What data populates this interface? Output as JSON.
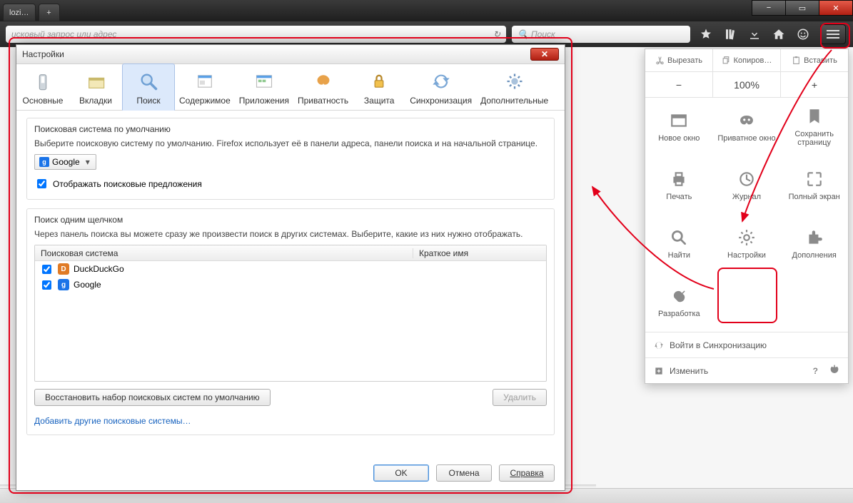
{
  "window": {
    "tab_label": "lozi…",
    "addr_placeholder": "исковый запрос или адрес",
    "search_placeholder": "Поиск"
  },
  "toolbar_icons": [
    "star",
    "library",
    "download",
    "home",
    "face",
    "menu"
  ],
  "menu": {
    "cut": "Вырезать",
    "copy": "Копиров…",
    "paste": "Вставить",
    "zoom_minus": "−",
    "zoom_value": "100%",
    "zoom_plus": "+",
    "grid": [
      {
        "label": "Новое окно"
      },
      {
        "label": "Приватное окно"
      },
      {
        "label": "Сохранить страницу"
      },
      {
        "label": "Печать"
      },
      {
        "label": "Журнал"
      },
      {
        "label": "Полный экран"
      },
      {
        "label": "Найти"
      },
      {
        "label": "Настройки"
      },
      {
        "label": "Дополнения"
      },
      {
        "label": "Разработка"
      }
    ],
    "sync": "Войти в Синхронизацию",
    "customize": "Изменить"
  },
  "dialog": {
    "title": "Настройки",
    "tabs": [
      "Основные",
      "Вкладки",
      "Поиск",
      "Содержимое",
      "Приложения",
      "Приватность",
      "Защита",
      "Синхронизация",
      "Дополнительные"
    ],
    "default_group": {
      "title": "Поисковая система по умолчанию",
      "help": "Выберите поисковую систему по умолчанию. Firefox использует её в панели адреса, панели поиска и на начальной странице.",
      "selected": "Google",
      "suggest_cb": "Отображать поисковые предложения"
    },
    "oneclick_group": {
      "title": "Поиск одним щелчком",
      "help": "Через панель поиска вы можете сразу же произвести поиск в других системах. Выберите, какие из них нужно отображать.",
      "col1": "Поисковая система",
      "col2": "Краткое имя",
      "engines": [
        {
          "name": "DuckDuckGo",
          "checked": true,
          "color": "#e07b26",
          "glyph": "D"
        },
        {
          "name": "Google",
          "checked": true,
          "color": "#1a73e8",
          "glyph": "g"
        }
      ],
      "restore": "Восстановить набор поисковых систем по умолчанию",
      "remove": "Удалить",
      "addlink": "Добавить другие поисковые системы…"
    },
    "buttons": {
      "ok": "OK",
      "cancel": "Отмена",
      "help": "Справка"
    }
  }
}
